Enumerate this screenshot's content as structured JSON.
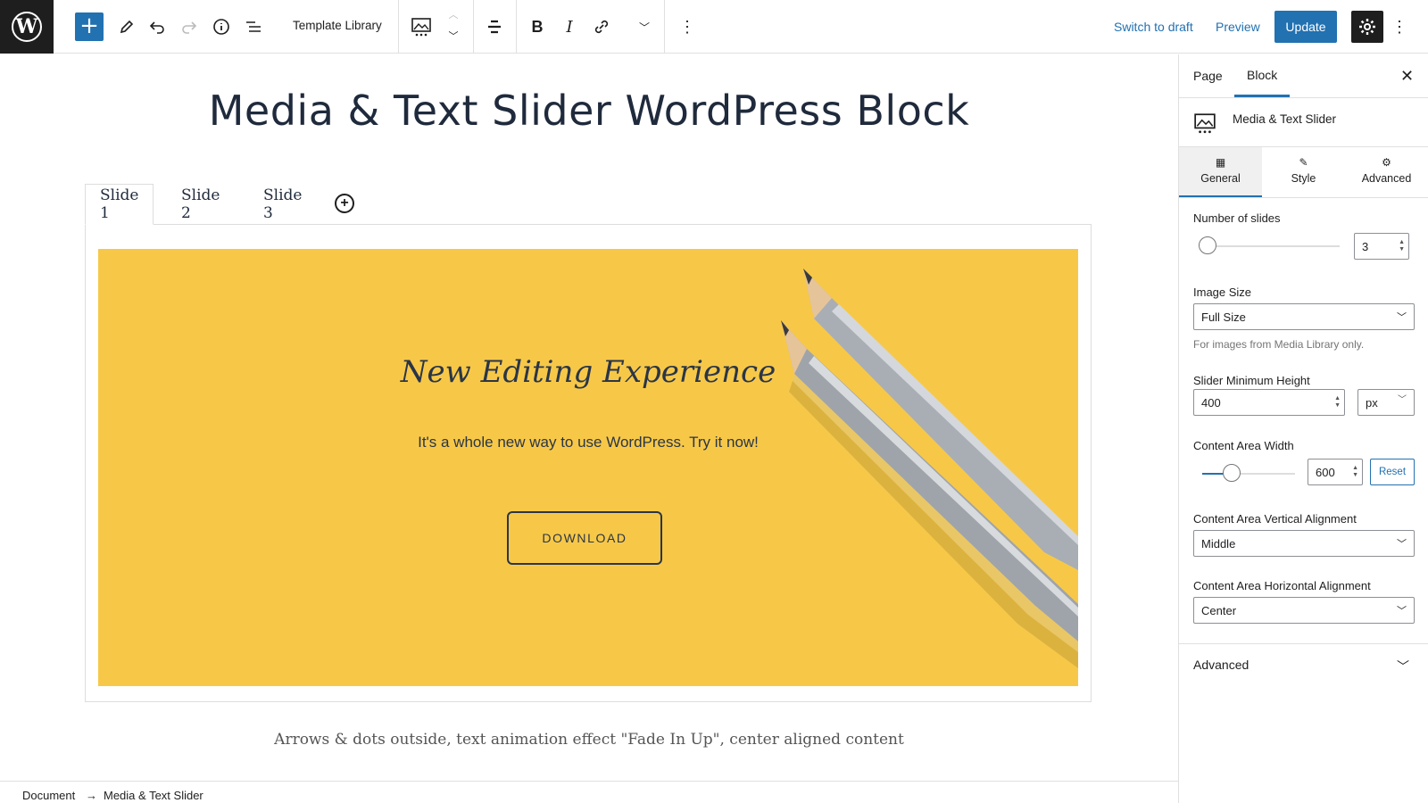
{
  "toolbar": {
    "template_library": "Template Library",
    "switch_to_draft": "Switch to draft",
    "preview": "Preview",
    "update": "Update",
    "add_symbol": "+",
    "more_symbol": "⋮"
  },
  "editor": {
    "page_title": "Media & Text Slider WordPress Block",
    "tabs": [
      "Slide 1",
      "Slide 2",
      "Slide 3"
    ],
    "active_tab": "Slide 1",
    "slide": {
      "heading": "New Editing Experience",
      "subtext": "It's a whole new way to use WordPress. Try it now!",
      "button": "DOWNLOAD",
      "background_color": "#f7c848"
    },
    "caption": "Arrows & dots outside, text animation effect \"Fade In Up\", center aligned content"
  },
  "breadcrumb": {
    "items": [
      "Document",
      "Media & Text Slider"
    ],
    "separator": "→"
  },
  "sidebar": {
    "tabs": [
      "Page",
      "Block"
    ],
    "active_tab": "Block",
    "block_name": "Media & Text Slider",
    "panel_tabs": [
      {
        "label": "General",
        "icon": "layout-icon"
      },
      {
        "label": "Style",
        "icon": "brush-icon"
      },
      {
        "label": "Advanced",
        "icon": "gear-icon"
      }
    ],
    "number_of_slides": {
      "label": "Number of slides",
      "value": "3",
      "slider_fraction": 0.0
    },
    "image_size": {
      "label": "Image Size",
      "value": "Full Size",
      "help": "For images from Media Library only."
    },
    "slider_min_height": {
      "label": "Slider Minimum Height",
      "value": "400",
      "unit": "px"
    },
    "content_area_width": {
      "label": "Content Area Width",
      "value": "600",
      "reset": "Reset",
      "slider_fraction": 0.3
    },
    "vertical_alignment": {
      "label": "Content Area Vertical Alignment",
      "value": "Middle"
    },
    "horizontal_alignment": {
      "label": "Content Area Horizontal Alignment",
      "value": "Center"
    },
    "advanced_panel": "Advanced"
  },
  "colors": {
    "accent": "#2271b1",
    "dark": "#1e1e1e",
    "slide_bg": "#f7c848"
  }
}
